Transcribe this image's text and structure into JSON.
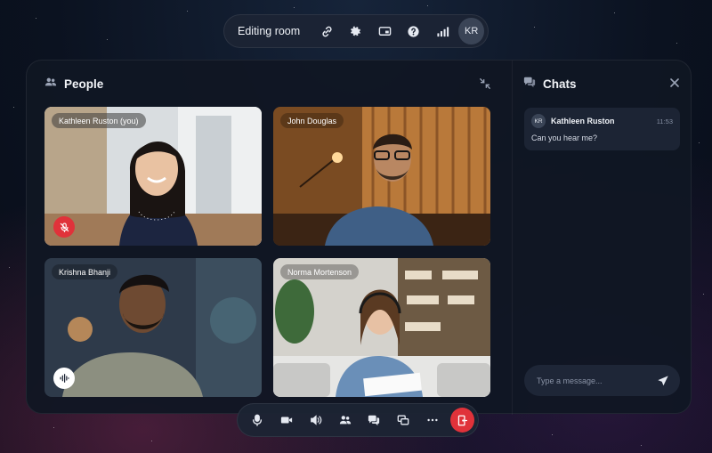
{
  "room": {
    "title": "Editing room",
    "user_initials": "KR"
  },
  "people": {
    "heading": "People",
    "participants": [
      {
        "name": "Kathleen Ruston (you)",
        "mic": "muted"
      },
      {
        "name": "John Douglas",
        "mic": "on"
      },
      {
        "name": "Krishna Bhanji",
        "mic": "speaking"
      },
      {
        "name": "Norma Mortenson",
        "mic": "on"
      }
    ]
  },
  "chat": {
    "heading": "Chats",
    "messages": [
      {
        "initials": "KR",
        "author": "Kathleen Ruston",
        "time": "11:53",
        "text": "Can you hear me?"
      }
    ],
    "input_placeholder": "Type a message..."
  },
  "toolbar_top_icons": [
    "link-icon",
    "gear-icon",
    "screen-icon",
    "help-icon",
    "signal-icon"
  ],
  "toolbar_bottom_icons": [
    "microphone-icon",
    "camera-icon",
    "speaker-icon",
    "people-icon",
    "chat-icon",
    "share-screen-icon",
    "more-icon",
    "leave-icon"
  ],
  "colors": {
    "accent_red": "#e0323a",
    "panel": "#101623",
    "chip": "#1c2434"
  }
}
